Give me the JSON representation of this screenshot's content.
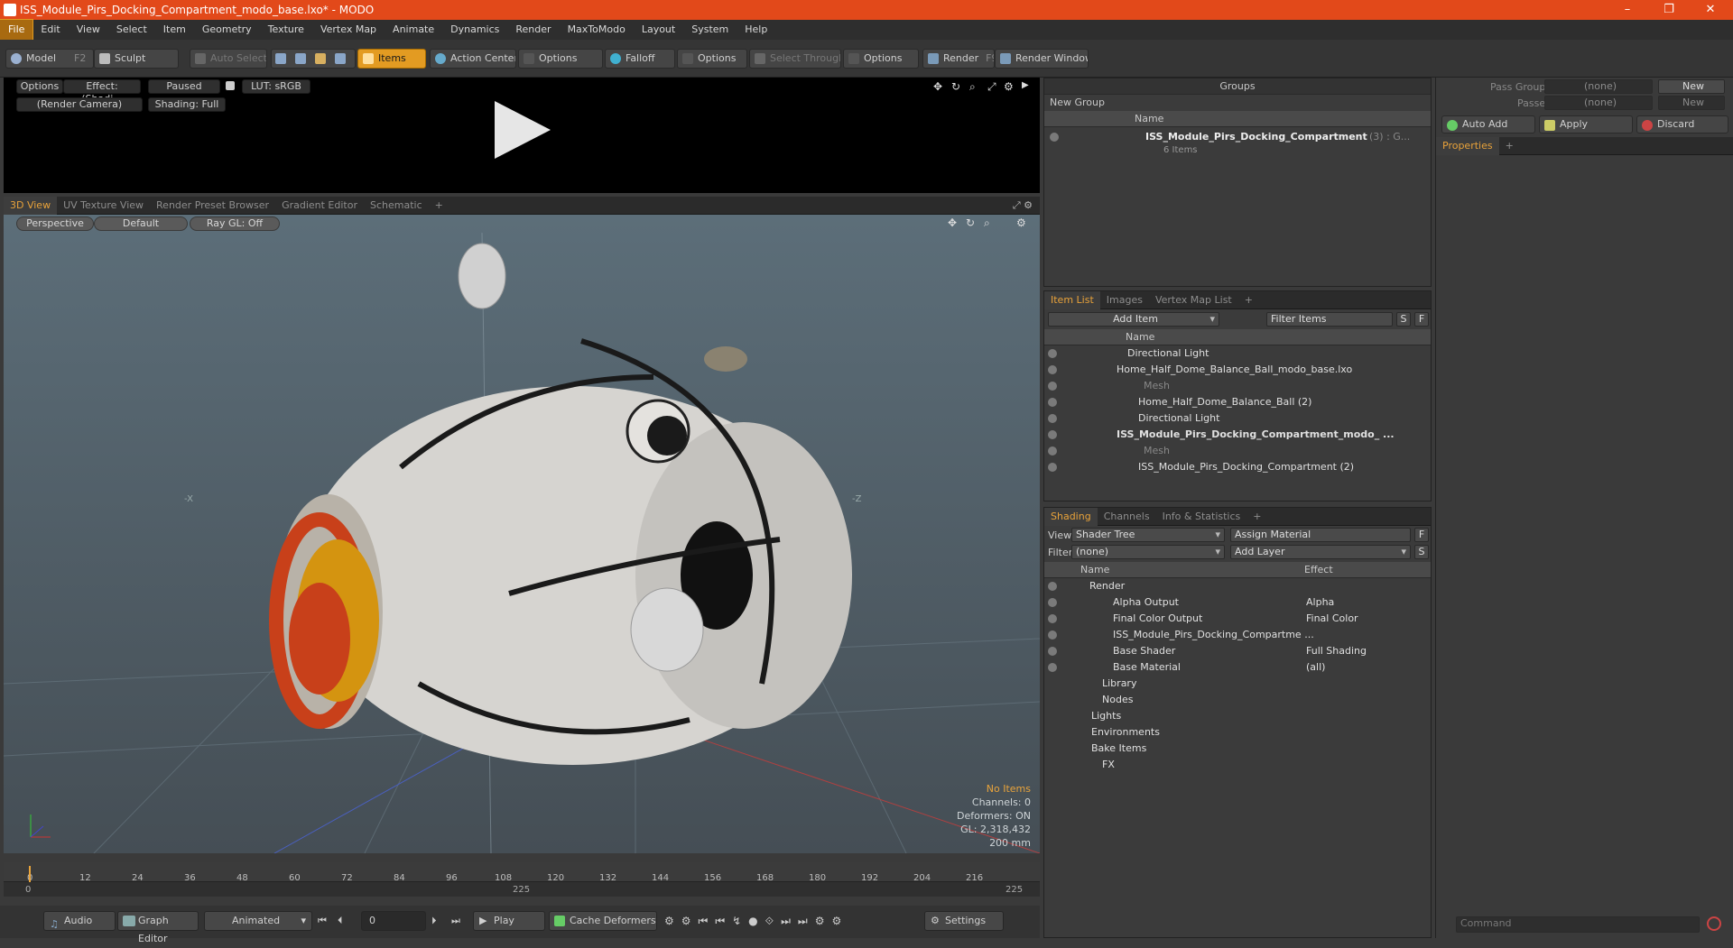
{
  "titlebar": {
    "title": "ISS_Module_Pirs_Docking_Compartment_modo_base.lxo* - MODO",
    "min": "–",
    "max": "❐",
    "close": "✕"
  },
  "menu": [
    "File",
    "Edit",
    "View",
    "Select",
    "Item",
    "Geometry",
    "Texture",
    "Vertex Map",
    "Animate",
    "Dynamics",
    "Render",
    "MaxToModo",
    "Layout",
    "System",
    "Help"
  ],
  "toolbar": {
    "model": "Model",
    "model_key": "F2",
    "sculpt": "Sculpt",
    "auto_select": "Auto Select",
    "items": "Items",
    "action_center": "Action Center",
    "options1": "Options",
    "falloff": "Falloff",
    "options2": "Options",
    "select_through": "Select Through",
    "options3": "Options",
    "render": "Render",
    "render_key": "F9",
    "render_window": "Render Window"
  },
  "preview": {
    "options": "Options",
    "effect": "Effect: (Shadi...",
    "paused": "Paused",
    "lut": "LUT: sRGB",
    "camera": "(Render Camera)",
    "shading": "Shading: Full"
  },
  "viewtabs": [
    "3D View",
    "UV Texture View",
    "Render Preset Browser",
    "Gradient Editor",
    "Schematic",
    "+"
  ],
  "viewport": {
    "perspective": "Perspective",
    "default": "Default",
    "raygl": "Ray GL: Off",
    "stats": {
      "no_items": "No Items",
      "channels": "Channels: 0",
      "deformers": "Deformers: ON",
      "gl": "GL: 2,318,432",
      "scale": "200 mm"
    },
    "axis_minus_x": "-X",
    "axis_minus_z": "-Z"
  },
  "timeline": {
    "ticks": [
      "0",
      "12",
      "24",
      "36",
      "48",
      "60",
      "72",
      "84",
      "96",
      "108",
      "120",
      "132",
      "144",
      "156",
      "168",
      "180",
      "192",
      "204",
      "216"
    ],
    "start": "0",
    "mid": "225",
    "end": "225"
  },
  "bottom": {
    "audio": "Audio",
    "graph_editor": "Graph Editor",
    "animated": "Animated",
    "frame": "0",
    "play": "Play",
    "cache": "Cache Deformers",
    "settings": "Settings"
  },
  "groups": {
    "title": "Groups",
    "new_group": "New Group",
    "col_name": "Name",
    "item": "ISS_Module_Pirs_Docking_Compartment",
    "item_suffix": "(3) : G...",
    "item_sub": "6 Items"
  },
  "itemlist": {
    "tabs": [
      "Item List",
      "Images",
      "Vertex Map List",
      "+"
    ],
    "add_item": "Add Item",
    "filter": "Filter Items",
    "s": "S",
    "f": "F",
    "col_name": "Name",
    "rows": [
      {
        "label": "Directional Light",
        "indent": 92,
        "dim": false,
        "bold": false
      },
      {
        "label": "Home_Half_Dome_Balance_Ball_modo_base.lxo",
        "indent": 80,
        "dim": false,
        "bold": false
      },
      {
        "label": "Mesh",
        "indent": 110,
        "dim": true,
        "bold": false
      },
      {
        "label": "Home_Half_Dome_Balance_Ball (2)",
        "indent": 104,
        "dim": false,
        "bold": false
      },
      {
        "label": "Directional Light",
        "indent": 104,
        "dim": false,
        "bold": false
      },
      {
        "label": "ISS_Module_Pirs_Docking_Compartment_modo_ ...",
        "indent": 80,
        "dim": false,
        "bold": true
      },
      {
        "label": "Mesh",
        "indent": 110,
        "dim": true,
        "bold": false
      },
      {
        "label": "ISS_Module_Pirs_Docking_Compartment (2)",
        "indent": 104,
        "dim": false,
        "bold": false
      }
    ]
  },
  "shading": {
    "tabs": [
      "Shading",
      "Channels",
      "Info & Statistics",
      "+"
    ],
    "view_label": "View",
    "view_value": "Shader Tree",
    "assign": "Assign Material",
    "f": "F",
    "filter_label": "Filter",
    "filter_value": "(none)",
    "add_layer": "Add Layer",
    "s": "S",
    "col_name": "Name",
    "col_effect": "Effect",
    "rows": [
      {
        "name": "Render",
        "effect": "",
        "indent": 50
      },
      {
        "name": "Alpha Output",
        "effect": "Alpha",
        "indent": 76
      },
      {
        "name": "Final Color Output",
        "effect": "Final Color",
        "indent": 76
      },
      {
        "name": "ISS_Module_Pirs_Docking_Compartme ...",
        "effect": "",
        "indent": 76
      },
      {
        "name": "Base Shader",
        "effect": "Full Shading",
        "indent": 76
      },
      {
        "name": "Base Material",
        "effect": "(all)",
        "indent": 76
      },
      {
        "name": "Library",
        "effect": "",
        "indent": 64
      },
      {
        "name": "Nodes",
        "effect": "",
        "indent": 64
      },
      {
        "name": "Lights",
        "effect": "",
        "indent": 52
      },
      {
        "name": "Environments",
        "effect": "",
        "indent": 52
      },
      {
        "name": "Bake Items",
        "effect": "",
        "indent": 52
      },
      {
        "name": "FX",
        "effect": "",
        "indent": 64
      }
    ]
  },
  "right": {
    "pass_groups": "Pass Groups",
    "pass_groups_value": "(none)",
    "new": "New",
    "passes": "Passes",
    "passes_value": "(none)",
    "new2": "New",
    "auto_add": "Auto Add",
    "apply": "Apply",
    "discard": "Discard",
    "properties": "Properties",
    "plus": "+",
    "command": "Command"
  },
  "colors": {
    "accent": "#e39b22",
    "titlebar": "#e2491a"
  }
}
